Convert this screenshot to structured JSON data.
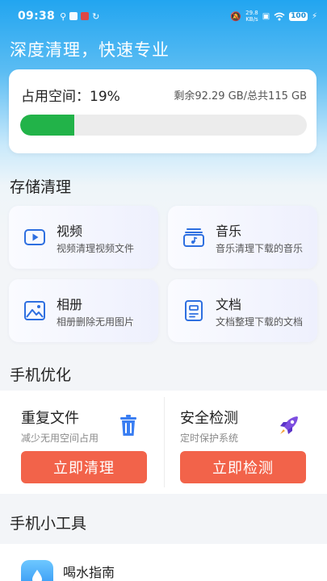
{
  "status_bar": {
    "time": "09:38",
    "net_speed_value": "29.8",
    "net_speed_unit": "KB/s",
    "battery": "100"
  },
  "header": {
    "headline": "深度清理，快速专业"
  },
  "storage": {
    "used_label": "占用空间：19%",
    "used_percent": 19,
    "remaining_text": "剩余92.29 GB/总共115 GB",
    "progress_color": "#22b349"
  },
  "storage_clean": {
    "section_title": "存储清理",
    "cards": [
      {
        "title": "视频",
        "subtitle": "视频清理视频文件",
        "icon": "video-icon"
      },
      {
        "title": "音乐",
        "subtitle": "音乐清理下载的音乐",
        "icon": "music-icon"
      },
      {
        "title": "相册",
        "subtitle": "相册删除无用图片",
        "icon": "photo-album-icon"
      },
      {
        "title": "文档",
        "subtitle": "文档整理下载的文档",
        "icon": "document-icon"
      }
    ]
  },
  "optimize": {
    "section_title": "手机优化",
    "left": {
      "title": "重复文件",
      "subtitle": "减少无用空间占用",
      "button": "立即清理",
      "icon": "trash-icon"
    },
    "right": {
      "title": "安全检测",
      "subtitle": "定时保护系统",
      "button": "立即检测",
      "icon": "rocket-icon"
    },
    "button_color": "#f2634a"
  },
  "tools": {
    "section_title": "手机小工具",
    "items": [
      {
        "name": "喝水指南",
        "icon": "water-drop-icon"
      }
    ]
  },
  "colors": {
    "accent": "#22a5f0",
    "primary_blue": "#2e6fe0"
  }
}
